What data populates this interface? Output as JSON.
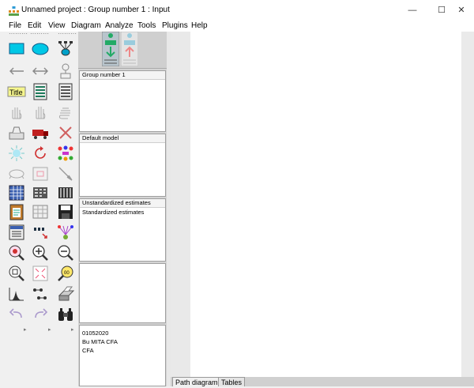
{
  "window": {
    "title": "Unnamed project : Group number 1 : Input",
    "minimize": "—",
    "maximize": "☐",
    "close": "✕"
  },
  "menu": [
    "File",
    "Edit",
    "View",
    "Diagram",
    "Analyze",
    "Tools",
    "Plugins",
    "Help"
  ],
  "toolbox": {
    "title_tool_label": "Title"
  },
  "panels": {
    "groups": {
      "header": "Group number 1"
    },
    "models": {
      "header": "Default model"
    },
    "estimates": {
      "header": "Unstandardized estimates",
      "lines": [
        "Standardized estimates"
      ]
    },
    "files": {
      "lines": [
        "01052020",
        "Bu MITA CFA",
        "CFA"
      ]
    }
  },
  "tabs": [
    "Path diagram",
    "Tables"
  ],
  "colors": {
    "accent_cyan": "#00c8e6",
    "title_yellow": "#f5f58c",
    "window_bg": "#f0f0f0"
  }
}
